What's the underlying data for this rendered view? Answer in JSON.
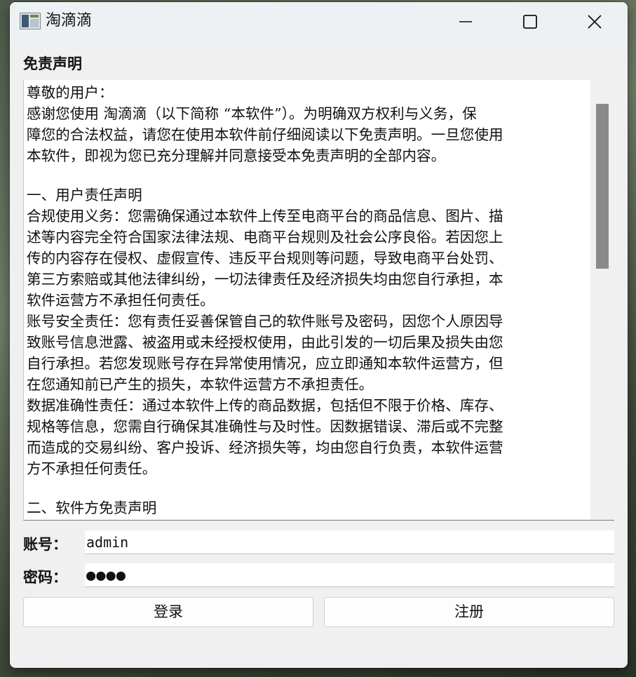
{
  "window": {
    "title": "淘滴滴",
    "controls": {
      "minimize": "minimize-icon",
      "maximize": "maximize-icon",
      "close": "close-icon"
    }
  },
  "disclaimer": {
    "title": "免责声明",
    "lines": [
      "尊敬的用户：",
      "感谢您使用 淘滴滴（以下简称 “本软件”）。为明确双方权利与义务，保",
      "障您的合法权益，请您在使用本软件前仔细阅读以下免责声明。一旦您使用",
      "本软件，即视为您已充分理解并同意接受本免责声明的全部内容。",
      "",
      "一、用户责任声明",
      "合规使用义务：您需确保通过本软件上传至电商平台的商品信息、图片、描",
      "述等内容完全符合国家法律法规、电商平台规则及社会公序良俗。若因您上",
      "传的内容存在侵权、虚假宣传、违反平台规则等问题，导致电商平台处罚、",
      "第三方索赔或其他法律纠纷，一切法律责任及经济损失均由您自行承担，本",
      "软件运营方不承担任何责任。",
      "账号安全责任：您有责任妥善保管自己的软件账号及密码，因您个人原因导",
      "致账号信息泄露、被盗用或未经授权使用，由此引发的一切后果及损失由您",
      "自行承担。若您发现账号存在异常使用情况，应立即通知本软件运营方，但",
      "在您通知前已产生的损失，本软件运营方不承担责任。",
      "数据准确性责任：通过本软件上传的商品数据，包括但不限于价格、库存、",
      "规格等信息，您需自行确保其准确性与及时性。因数据错误、滞后或不完整",
      "而造成的交易纠纷、客户投诉、经济损失等，均由您自行负责，本软件运营",
      "方不承担任何责任。",
      "",
      "二、软件方免责声明"
    ]
  },
  "form": {
    "account_label": "账号：",
    "account_value": "admin",
    "password_label": "密码：",
    "password_value": "●●●●"
  },
  "buttons": {
    "login": "登录",
    "register": "注册"
  }
}
